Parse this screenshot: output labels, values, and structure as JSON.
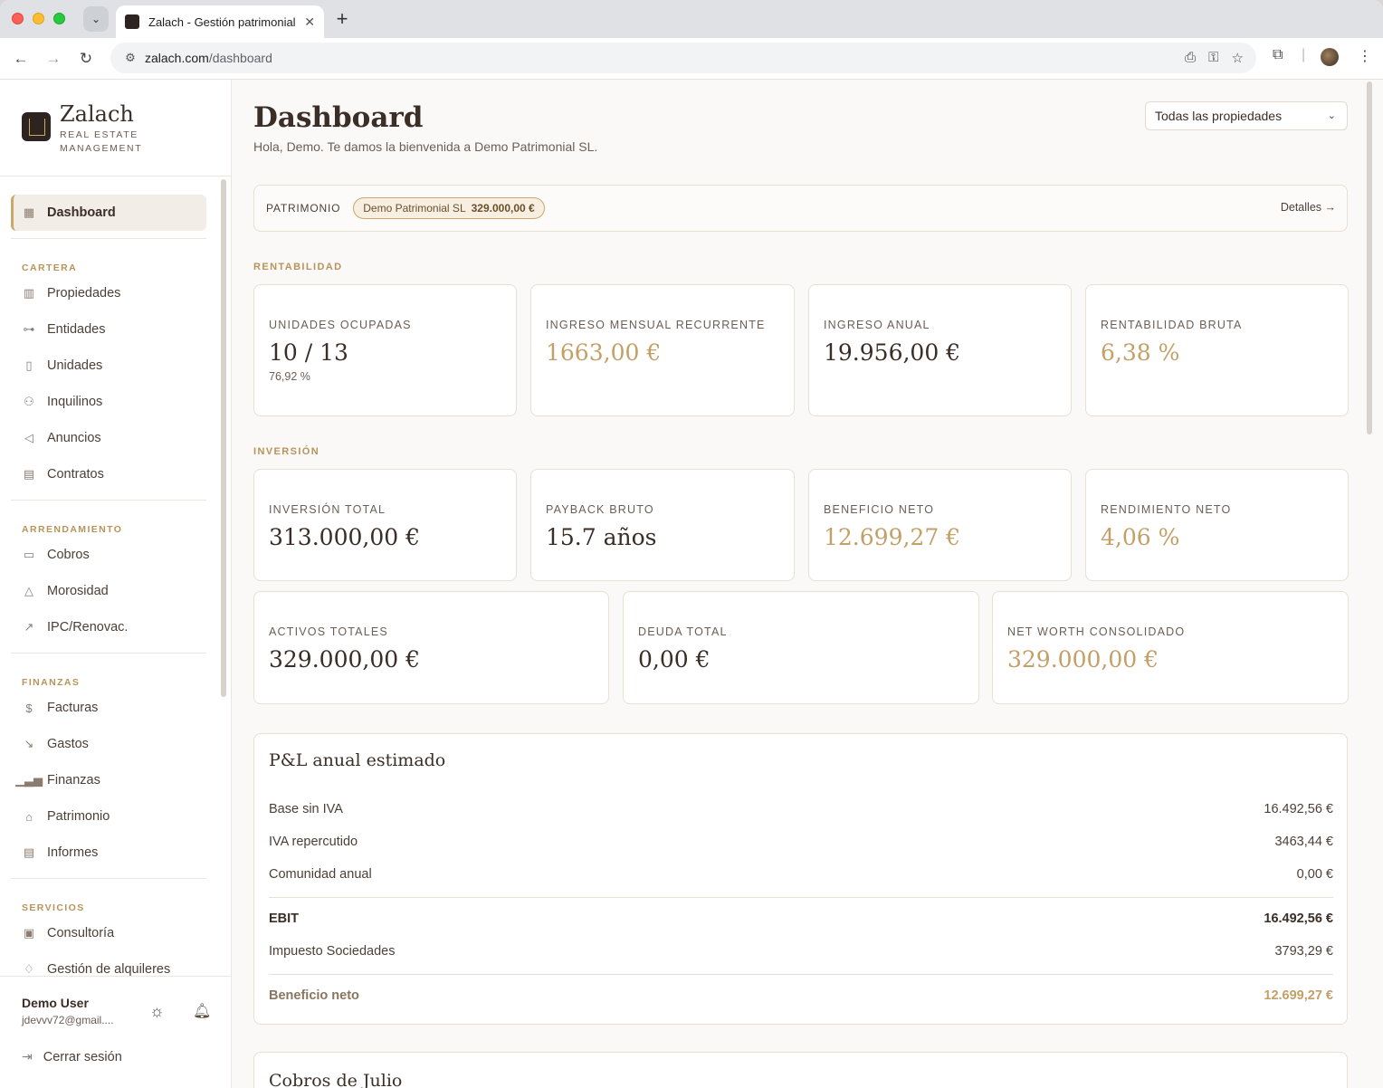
{
  "browser": {
    "tab_title": "Zalach - Gestión patrimonial I",
    "url_domain": "zalach.com",
    "url_path": "/dashboard"
  },
  "brand": {
    "name": "Zalach",
    "subtitle_line1": "REAL ESTATE",
    "subtitle_line2": "MANAGEMENT"
  },
  "sidebar": {
    "active": "Dashboard",
    "sections": [
      {
        "label": "CARTERA",
        "items": [
          "Propiedades",
          "Entidades",
          "Unidades",
          "Inquilinos",
          "Anuncios",
          "Contratos"
        ]
      },
      {
        "label": "ARRENDAMIENTO",
        "items": [
          "Cobros",
          "Morosidad",
          "IPC/Renovac."
        ]
      },
      {
        "label": "FINANZAS",
        "items": [
          "Facturas",
          "Gastos",
          "Finanzas",
          "Patrimonio",
          "Informes"
        ]
      },
      {
        "label": "SERVICIOS",
        "items": [
          "Consultoría",
          "Gestión de alquileres"
        ]
      }
    ]
  },
  "user": {
    "name": "Demo User",
    "email": "jdevvv72@gmail....",
    "logout": "Cerrar sesión"
  },
  "header": {
    "title": "Dashboard",
    "subtitle": "Hola, Demo. Te damos la bienvenida a Demo Patrimonial SL.",
    "property_select": "Todas las propiedades"
  },
  "patrimonio": {
    "label": "PATRIMONIO",
    "chip_name": "Demo Patrimonial SL",
    "chip_value": "329.000,00 €",
    "details": "Detalles →"
  },
  "rentabilidad": {
    "label": "RENTABILIDAD",
    "cards": [
      {
        "label": "UNIDADES OCUPADAS",
        "value": "10 / 13",
        "sub": "76,92 %"
      },
      {
        "label": "INGRESO MENSUAL RECURRENTE",
        "value": "1663,00 €"
      },
      {
        "label": "INGRESO ANUAL",
        "value": "19.956,00 €"
      },
      {
        "label": "RENTABILIDAD BRUTA",
        "value": "6,38 %"
      }
    ]
  },
  "inversion": {
    "label": "INVERSIÓN",
    "cards": [
      {
        "label": "INVERSIÓN TOTAL",
        "value": "313.000,00 €"
      },
      {
        "label": "PAYBACK BRUTO",
        "value": "15.7 años"
      },
      {
        "label": "BENEFICIO NETO",
        "value": "12.699,27 €"
      },
      {
        "label": "RENDIMIENTO NETO",
        "value": "4,06 %"
      }
    ],
    "cards2": [
      {
        "label": "ACTIVOS TOTALES",
        "value": "329.000,00 €"
      },
      {
        "label": "DEUDA TOTAL",
        "value": "0,00 €"
      },
      {
        "label": "NET WORTH CONSOLIDADO",
        "value": "329.000,00 €"
      }
    ]
  },
  "pl": {
    "title": "P&L anual estimado",
    "rows": [
      {
        "label": "Base sin IVA",
        "value": "16.492,56 €"
      },
      {
        "label": "IVA repercutido",
        "value": "3463,44 €"
      },
      {
        "label": "Comunidad anual",
        "value": "0,00 €"
      },
      {
        "label": "EBIT",
        "value": "16.492,56 €"
      },
      {
        "label": "Impuesto Sociedades",
        "value": "3793,29 €"
      },
      {
        "label": "Beneficio neto",
        "value": "12.699,27 €"
      }
    ]
  },
  "cobros": {
    "title": "Cobros de Julio"
  },
  "colors": {
    "accent_gold": "#c2a068",
    "section_gold": "#b8935a",
    "text_dark": "#3a2e26",
    "bg": "#fbf9f7"
  }
}
